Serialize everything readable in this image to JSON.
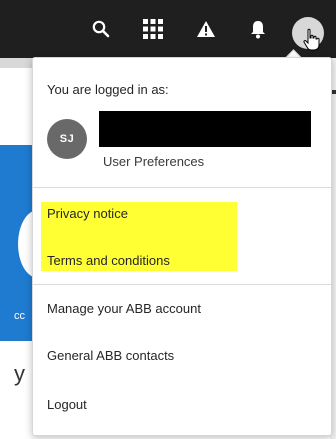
{
  "topbar": {
    "icons": [
      "search-icon",
      "apps-grid-icon",
      "warning-icon",
      "bell-icon",
      "user-avatar-icon"
    ]
  },
  "background": {
    "fragment_co": "cc",
    "fragment_y": "y"
  },
  "menu": {
    "logged_in_label": "You are logged in as:",
    "initials": "SJ",
    "user_preferences": "User Preferences",
    "privacy_notice": "Privacy notice",
    "terms": "Terms and conditions",
    "manage_account": "Manage your ABB account",
    "contacts": "General ABB contacts",
    "logout": "Logout"
  },
  "colors": {
    "topbar": "#1f1f1f",
    "avatar": "#696969",
    "highlight": "#ffff33",
    "page_blue": "#1e7bd0"
  }
}
